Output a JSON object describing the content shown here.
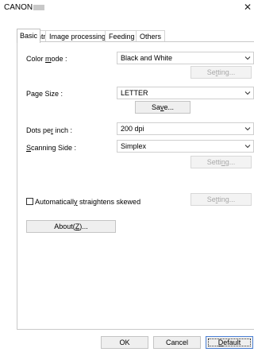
{
  "window": {
    "title": "CANON"
  },
  "tabs": [
    "Basic",
    "Brightness",
    "Image processing",
    "Feeding",
    "Others"
  ],
  "basic": {
    "color_mode": {
      "label_pre": "Color ",
      "label_key": "m",
      "label_post": "ode :",
      "value": "Black and White",
      "setting_pre": "Se",
      "setting_key": "t",
      "setting_post": "ting..."
    },
    "page_size": {
      "label": "Page Size :",
      "value": "LETTER",
      "save_pre": "Sa",
      "save_key": "v",
      "save_post": "e..."
    },
    "dots_per_inch": {
      "label_pre": "Dots pe",
      "label_key": "r",
      "label_post": " inch :",
      "value": "200 dpi"
    },
    "scanning_side": {
      "label_pre": "",
      "label_key": "S",
      "label_post": "canning Side :",
      "value": "Simplex",
      "setting_pre": "Setti",
      "setting_key": "n",
      "setting_post": "g..."
    },
    "auto_straighten": {
      "label_pre": "Automaticall",
      "label_key": "y",
      "label_post": " straightens skewed",
      "checked": false,
      "setting_pre": "Se",
      "setting_key": "t",
      "setting_post": "ting..."
    },
    "about": {
      "label_pre": "About(",
      "label_key": "Z",
      "label_post": ")..."
    }
  },
  "footer": {
    "ok": "OK",
    "cancel": "Cancel",
    "default_pre": "",
    "default_key": "D",
    "default_post": "efault"
  }
}
